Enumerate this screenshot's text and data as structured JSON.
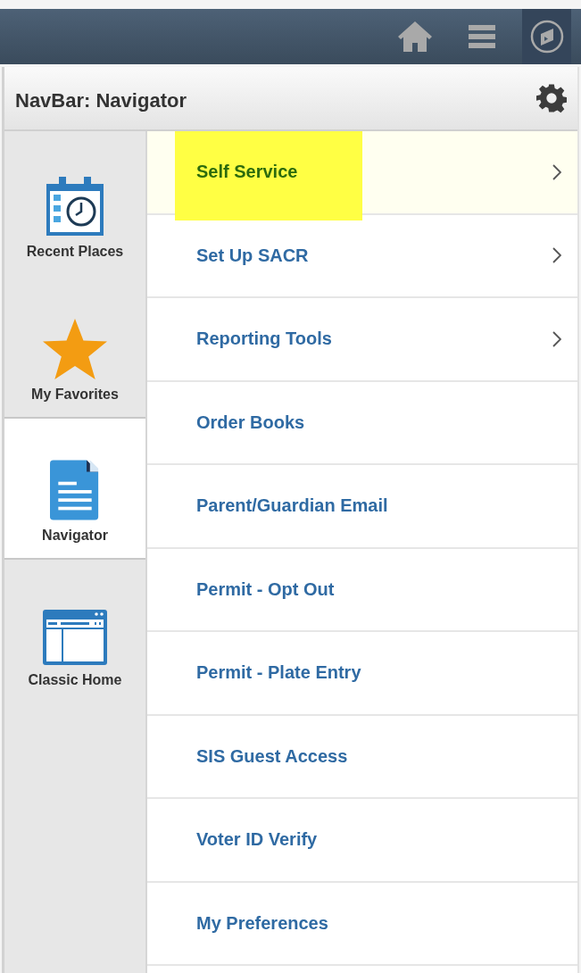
{
  "top_bar": {
    "buttons": [
      {
        "kind": "home",
        "selected": false
      },
      {
        "kind": "menu",
        "selected": false
      },
      {
        "kind": "navigator",
        "selected": true
      }
    ]
  },
  "panel": {
    "title": "NavBar: Navigator"
  },
  "sidebar": {
    "items": [
      {
        "label": "Recent Places",
        "kind": "recent",
        "selected": false
      },
      {
        "label": "My Favorites",
        "kind": "favorites",
        "selected": false
      },
      {
        "label": "Navigator",
        "kind": "navigator",
        "selected": true
      },
      {
        "label": "Classic Home",
        "kind": "classic",
        "selected": false
      }
    ]
  },
  "menu": {
    "items": [
      {
        "label": "Self Service",
        "has_submenu": true,
        "selected": true,
        "highlighted": true
      },
      {
        "label": "Set Up SACR",
        "has_submenu": true,
        "selected": false,
        "highlighted": false
      },
      {
        "label": "Reporting Tools",
        "has_submenu": true,
        "selected": false,
        "highlighted": false
      },
      {
        "label": "Order Books",
        "has_submenu": false,
        "selected": false,
        "highlighted": false
      },
      {
        "label": "Parent/Guardian Email",
        "has_submenu": false,
        "selected": false,
        "highlighted": false
      },
      {
        "label": "Permit - Opt Out",
        "has_submenu": false,
        "selected": false,
        "highlighted": false
      },
      {
        "label": "Permit - Plate Entry",
        "has_submenu": false,
        "selected": false,
        "highlighted": false
      },
      {
        "label": "SIS Guest Access",
        "has_submenu": false,
        "selected": false,
        "highlighted": false
      },
      {
        "label": "Voter ID Verify",
        "has_submenu": false,
        "selected": false,
        "highlighted": false
      },
      {
        "label": "My Preferences",
        "has_submenu": false,
        "selected": false,
        "highlighted": false
      }
    ]
  }
}
